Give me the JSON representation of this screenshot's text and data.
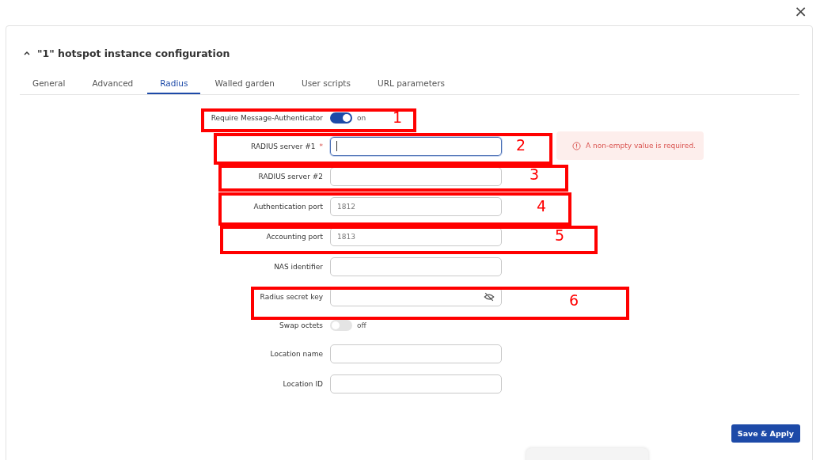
{
  "close_label": "×",
  "section": {
    "title": "\"1\" hotspot instance configuration",
    "expanded": true
  },
  "tabs": [
    {
      "label": "General",
      "selected": false
    },
    {
      "label": "Advanced",
      "selected": false
    },
    {
      "label": "Radius",
      "selected": true
    },
    {
      "label": "Walled garden",
      "selected": false
    },
    {
      "label": "User scripts",
      "selected": false
    },
    {
      "label": "URL parameters",
      "selected": false
    }
  ],
  "fields": [
    {
      "kind": "toggle",
      "label": "Require Message-Authenticator",
      "on": true,
      "state_text": "on",
      "annotation": "1"
    },
    {
      "kind": "text",
      "label": "RADIUS server #1",
      "required": true,
      "focused": true,
      "error": "A non-empty value is required.",
      "annotation": "2"
    },
    {
      "kind": "text",
      "label": "RADIUS server #2",
      "required": false,
      "focused": false,
      "annotation": "3"
    },
    {
      "kind": "text",
      "label": "Authentication port",
      "required": false,
      "focused": false,
      "placeholder": "1812",
      "annotation": "4"
    },
    {
      "kind": "text",
      "label": "Accounting port",
      "required": false,
      "focused": false,
      "placeholder": "1813",
      "annotation": "5"
    },
    {
      "kind": "text",
      "label": "NAS identifier",
      "required": false,
      "focused": false
    },
    {
      "kind": "password",
      "label": "Radius secret key",
      "required": false,
      "focused": false,
      "annotation": "6"
    },
    {
      "kind": "toggle",
      "label": "Swap octets",
      "on": false,
      "state_text": "off"
    },
    {
      "kind": "text",
      "label": "Location name",
      "required": false,
      "focused": false
    },
    {
      "kind": "text",
      "label": "Location ID",
      "required": false,
      "focused": false
    }
  ],
  "required_mark": "*",
  "save_button": "Save & Apply"
}
